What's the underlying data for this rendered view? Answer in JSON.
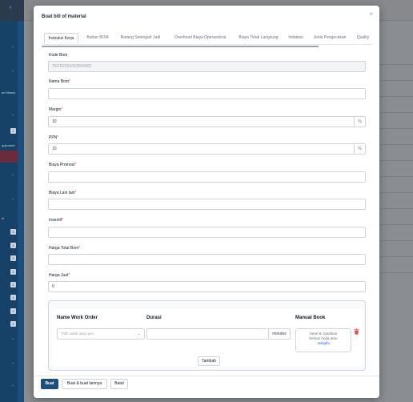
{
  "modal": {
    "title": "Buat bill of material",
    "close_label": "×"
  },
  "tabs": [
    {
      "label": "Instruksi Kerja"
    },
    {
      "label": "Bahan BOM"
    },
    {
      "label": "Barang Setengah Jadi"
    },
    {
      "label": "Overhead Biaya Operasional"
    },
    {
      "label": "Biaya Tidak Langsung"
    },
    {
      "label": "Instalasi"
    },
    {
      "label": "Jenis Pengecekan"
    },
    {
      "label": "Quality"
    }
  ],
  "fields": {
    "kode_bom": {
      "label": "Kode Bom",
      "value": "TEFR2001052500002"
    },
    "nama_bom": {
      "label": "Nama Bom",
      "value": ""
    },
    "margin": {
      "label": "Margin",
      "value": "10",
      "suffix": "%"
    },
    "ppn": {
      "label": "PPN",
      "value": "10",
      "suffix": "%"
    },
    "biaya_promosi": {
      "label": "Biaya Promosi",
      "value": ""
    },
    "biaya_lain": {
      "label": "Biaya Lain lain",
      "value": ""
    },
    "insentif": {
      "label": "Insentif",
      "value": ""
    },
    "harga_total_bom": {
      "label": "Harga Total Bom",
      "value": ""
    },
    "harga_jual": {
      "label": "Harga Jual",
      "value": "0"
    }
  },
  "work_order": {
    "col_name": "Name Work Order",
    "col_durasi": "Durasi",
    "col_manual": "Manual Book",
    "select_placeholder": "Pilih salah satu opsi",
    "durasi_suffix": "minutes",
    "upload_line1": "Seret & Jatuhkan",
    "upload_line2": "berkas Anda atau",
    "upload_link": "Jelajahi",
    "add_label": "Tambah"
  },
  "footer": {
    "save_label": "Buat",
    "save_new_label": "Buat & buat lainnya",
    "cancel_label": "Batal"
  },
  "sidebar_bg": {
    "text1": "an Masuk",
    "text2": "quipment",
    "text3": "si",
    "badges": [
      "5",
      "4",
      "3",
      "2",
      "1",
      "4",
      "3",
      "1",
      "2"
    ]
  },
  "colors": {
    "primary": "#1e4f7c",
    "sidebar": "#1b4f7a",
    "required": "#ef4444",
    "link": "#2563eb"
  }
}
